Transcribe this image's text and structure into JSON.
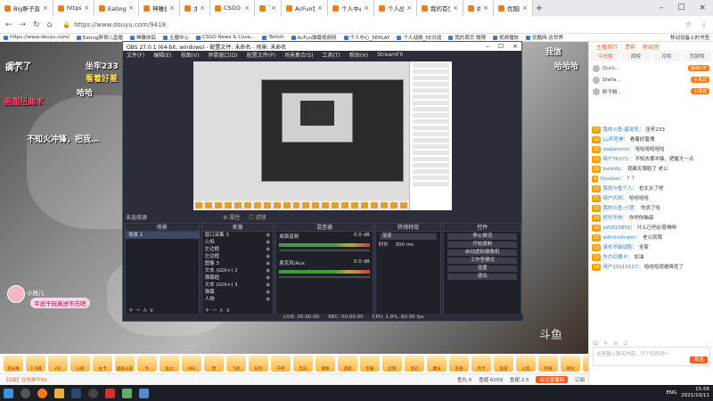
{
  "tabs": [
    {
      "label": "Big胖子直播_CS:GO直播_斗鱼",
      "close": "×"
    },
    {
      "label": "https://www.douyu.com/",
      "close": "×"
    },
    {
      "label": "Eating胖哥儿直播_CS:GO",
      "close": "×"
    },
    {
      "label": "神雕侠侣-(「つ0」つ…",
      "close": "×"
    },
    {
      "label": "主播中心",
      "close": "×"
    },
    {
      "label": "CSGO News & Coverage",
      "close": "×"
    },
    {
      "label": "Twitch",
      "close": "×"
    },
    {
      "label": "AcFun弹幕视频网-认真你就输",
      "close": "×"
    },
    {
      "label": "个人中心_5EPLAY竞技平台",
      "close": "×"
    },
    {
      "label": "个人战绩_5E对战平台",
      "close": "×"
    },
    {
      "label": "我的首页 微博-随时随地发现",
      "close": "×"
    },
    {
      "label": "视频播放",
      "close": "×"
    },
    {
      "label": "优酷网-这世界很酷",
      "close": "×"
    }
  ],
  "addressbar": {
    "back": "←",
    "forward": "→",
    "reload": "↻",
    "home": "⌂",
    "url": "https://www.douyu.com/9418"
  },
  "bookmarks": [
    "https://www.douyu.com/",
    "Eating胖哥儿直播",
    "神雕侠侣",
    "主播中心",
    "CSGO News & Cove...",
    "Twitch",
    "AcFun弹幕视频网",
    "个人中心_5EPLAY",
    "个人战绩_5E对战",
    "我的首页 微博",
    "视频播放",
    "优酷网-这世界"
  ],
  "bookmarks_right": "移动设备上的书签",
  "danmu": [
    {
      "text": "我笑了",
      "color": "#ffffff"
    },
    {
      "text": "坐牢233",
      "color": "#ffffff"
    },
    {
      "text": "看着好羞",
      "color": "#ffe34d"
    },
    {
      "text": "哈哈",
      "color": "#ffffff"
    },
    {
      "text": "画面扭曲术",
      "color": "#ff4d6d"
    },
    {
      "text": "确了",
      "color": "#ffffff"
    },
    {
      "text": "我信",
      "color": "#ffffff"
    },
    {
      "text": "哈哈哈",
      "color": "#ffffff"
    },
    {
      "text": "不知火冲锋，把我…",
      "color": "#ffffff"
    }
  ],
  "stream_badge": {
    "name": "小贱儿",
    "tag": "平说干玩真进不去吧"
  },
  "stream_logo": "斗鱼",
  "obs": {
    "title": "OBS 27.0.1 (64-bit, windows) - 配置文件: 未命名 - 场景: 未命名",
    "menu": [
      "文件(F)",
      "编辑(E)",
      "视图(V)",
      "停靠窗口(D)",
      "配置文件(P)",
      "场景集合(S)",
      "工具(T)",
      "帮助(H)",
      "StreamFX"
    ],
    "scene_label": "未选择源",
    "scene_tools": [
      "⚙ 属性",
      "☐ 滤镜"
    ],
    "docks": {
      "scenes": {
        "title": "场景",
        "items": [
          "场景 1"
        ]
      },
      "sources": {
        "title": "来源",
        "items": [
          "窗口采集 3",
          "火焰",
          "左边框",
          "左边框",
          "图像 3",
          "文本 (GDI+) 2",
          "弹幕框",
          "文本 (GDI+) 3",
          "弹幕",
          "人物"
        ]
      },
      "mixer": {
        "title": "混音器",
        "channels": [
          {
            "name": "桌面音频",
            "db": "0.0 dB"
          },
          {
            "name": "麦克风/Aux",
            "db": "0.0 dB"
          }
        ]
      },
      "transitions": {
        "title": "转场特效",
        "type": "渐变",
        "duration_label": "时长",
        "duration": "300 ms"
      },
      "controls": {
        "title": "控件",
        "buttons": [
          "停止推流",
          "开始录制",
          "启动虚拟摄像机",
          "工作室模式",
          "设置",
          "退出"
        ]
      }
    },
    "status": [
      "LIVE: 00:00:00",
      "REC: 00:00:00",
      "CPU: 1.9%, 60.00 fps"
    ],
    "dock_foot": "+  −  ∧  ∨"
  },
  "right_panel": {
    "tabs": [
      "主播排行",
      "贵宾",
      "粉丝团"
    ],
    "subtabs": [
      "今日榜",
      "周榜",
      "月榜",
      "贡献榜"
    ],
    "ranks": [
      {
        "name": "Qucli…",
        "tag": "超级VIP"
      },
      {
        "name": "Stella…",
        "tag": "小贵宾"
      },
      {
        "name": "胖子鲱…",
        "tag": "小贵宾"
      }
    ],
    "messages": [
      {
        "lv": "17",
        "name": "我的斗鱼-最宠死：",
        "text": "坐牢233"
      },
      {
        "lv": "19",
        "name": "Lu不死神：",
        "text": "看着好羞愧"
      },
      {
        "lv": "20",
        "name": "daqianchu：",
        "text": "哈哈哈哈哈哈"
      },
      {
        "lv": "18",
        "name": "用户76371：",
        "text": "不知去哪冲锋，把握大一点"
      },
      {
        "lv": "20",
        "name": "batkids：",
        "text": "我都无限脸了 老公"
      },
      {
        "lv": "9",
        "name": "Onsdian：",
        "text": "？？"
      },
      {
        "lv": "22",
        "name": "我的斗鱼个人：",
        "text": "也太水了吧"
      },
      {
        "lv": "21",
        "name": "用户大树：",
        "text": "哈哈哈哈"
      },
      {
        "lv": "15",
        "name": "我的斗鱼-小慧：",
        "text": "你说了哈"
      },
      {
        "lv": "24",
        "name": "好尔不肉：",
        "text": "你吧你脑袋"
      },
      {
        "lv": "16",
        "name": "sd5815859：",
        "text": "什么已吧必喜喝喝"
      },
      {
        "lv": "25",
        "name": "administrator：",
        "text": "老公就我"
      },
      {
        "lv": "12",
        "name": "谁也不能战胜：",
        "text": "全家"
      },
      {
        "lv": "19",
        "name": "东方红楼卡：",
        "text": "加油"
      },
      {
        "lv": "18",
        "name": "用户1501S127：",
        "text": "哈哈哈就被爽死了"
      }
    ],
    "chat_icons": [
      "☺",
      "✎",
      "◎",
      "♫"
    ],
    "chat_placeholder": "这里输入聊天内容，打个招呼吧～",
    "send": "发送"
  },
  "gifts": [
    "荧光棒",
    "小飞碟",
    "PK",
    "火箭",
    "办卡",
    "超级火箭",
    "牛",
    "鱼丸",
    "666",
    "赞",
    "飞机",
    "好玩",
    "干杯",
    "告白",
    "谢谢",
    "游艇",
    "宝箱",
    "灯牌",
    "皇冠",
    "魔法",
    "鱼翅",
    "月卡",
    "鱼雷",
    "火焰",
    "护盾",
    "神龙",
    "爱心",
    "啤酒",
    "礼盒",
    "奖杯"
  ],
  "infobar": {
    "left": "【2级】在吃胖牛81",
    "right": [
      "鱼丸 0",
      "鱼翅 6209",
      "鱼翅 2.5",
      "关注直播间",
      "订阅"
    ]
  },
  "taskbar": {
    "lang": "ENG",
    "time": "15:56",
    "date": "2021/10/11"
  }
}
